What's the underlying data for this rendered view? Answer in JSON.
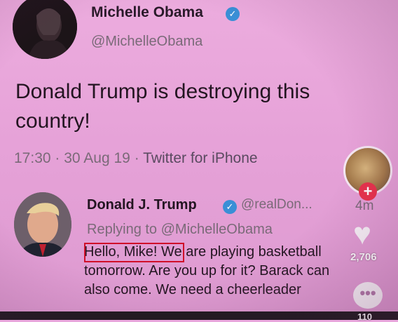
{
  "tweet": {
    "display_name": "Michelle Obama",
    "handle": "@MichelleObama",
    "text": "Donald Trump is destroying this country!",
    "time": "17:30",
    "date": "30 Aug 19",
    "source": "Twitter for iPhone",
    "separator": "·"
  },
  "reply": {
    "display_name": "Donald J. Trump",
    "handle": "@realDon...",
    "age": "4m",
    "replying_to": "Replying to @MichelleObama",
    "text": "Hello, Mike! We are playing basketball\ntomorrow. Are you up for it? Barack can\nalso come. We need a cheerleader"
  },
  "sidebar": {
    "follow_symbol": "+",
    "likes_count": "2,706",
    "comments_count": "110"
  },
  "colors": {
    "background": "#e8a6dc",
    "verified_badge": "#3a8fd6",
    "highlight_box": "#d0102a",
    "follow_button": "#e8324c"
  },
  "icons": [
    "verified-badge-icon",
    "heart-icon",
    "comment-icon",
    "plus-icon"
  ]
}
